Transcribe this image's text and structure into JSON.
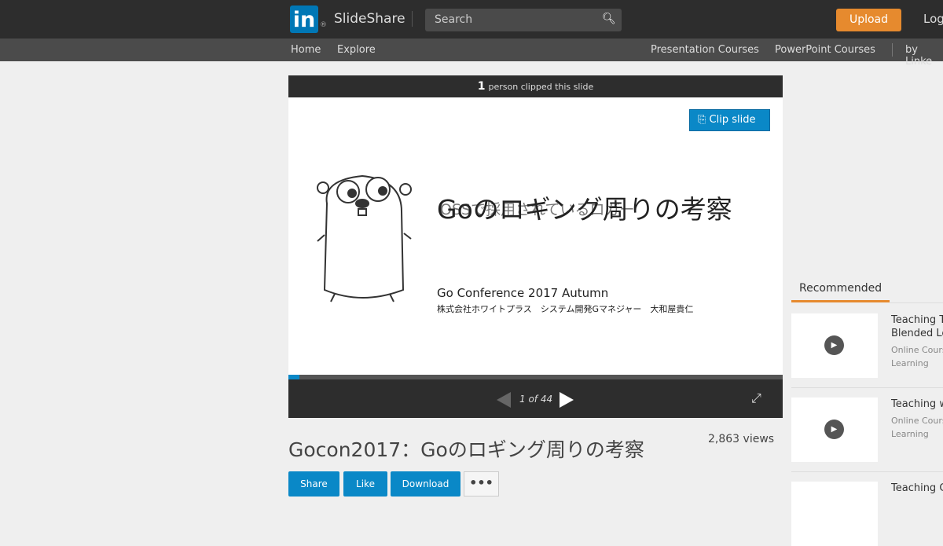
{
  "header": {
    "logo": "in",
    "reg": "®",
    "brand": "SlideShare",
    "search_placeholder": "Search",
    "upload": "Upload",
    "login": "Log"
  },
  "nav": {
    "home": "Home",
    "explore": "Explore",
    "presentation_courses": "Presentation Courses",
    "powerpoint_courses": "PowerPoint Courses",
    "by_linkedin": "by Linke"
  },
  "player": {
    "clip_count": "1",
    "clip_text": "person clipped this slide",
    "clip_button": "Clip slide",
    "slide_title": "Goのロギング周りの考察",
    "slide_overlay": "OSSで採用されているロガー",
    "slide_subtitle": "Go Conference 2017 Autumn",
    "slide_author": "株式会社ホワイトプラス　システム開発Gマネジャー　大和屋貴仁",
    "page": "1 of 44",
    "progress_fraction": 0.0227
  },
  "main": {
    "title": "Gocon2017：Goのロギング周りの考察",
    "views": "2,863 views",
    "share": "Share",
    "like": "Like",
    "download": "Download",
    "more": "•••"
  },
  "sidebar": {
    "heading": "Recommended",
    "items": [
      {
        "title": "Teaching T",
        "title2": "Blended Le",
        "sub": "Online Cours",
        "sub2": "Learning"
      },
      {
        "title": "Teaching w",
        "sub": "Online Cours",
        "sub2": "Learning"
      },
      {
        "title": "Teaching C"
      }
    ]
  }
}
